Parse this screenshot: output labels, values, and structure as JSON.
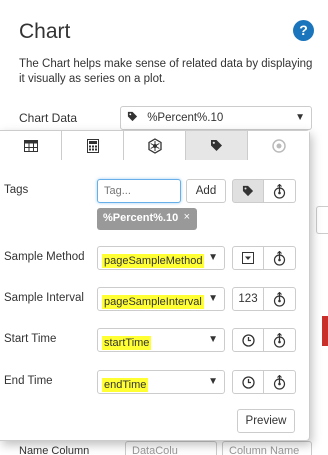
{
  "panel": {
    "title": "Chart",
    "description": "The Chart helps make sense of related data by displaying it visually as series on a plot.",
    "chart_data_label": "Chart Data",
    "chart_data_value": "%Percent%.10",
    "bottom_label": "Name Column",
    "bottom_select_1": "DataColu",
    "bottom_select_2": "Column Name"
  },
  "tabs": [
    {
      "icon": "table-icon"
    },
    {
      "icon": "calculator-icon"
    },
    {
      "icon": "hexagon-network-icon"
    },
    {
      "icon": "tag-icon",
      "active": true
    },
    {
      "icon": "record-icon"
    }
  ],
  "form": {
    "tags_label": "Tags",
    "tag_placeholder": "Tag...",
    "add_label": "Add",
    "chip_label": "%Percent%.10",
    "chip_remove": "×",
    "sample_method_label": "Sample Method",
    "sample_method_value": "pageSampleMethod",
    "sample_interval_label": "Sample Interval",
    "sample_interval_value": "pageSampleInterval",
    "sample_interval_unit": "123",
    "start_time_label": "Start Time",
    "start_time_value": "startTime",
    "end_time_label": "End Time",
    "end_time_value": "endTime",
    "preview_label": "Preview"
  },
  "colors": {
    "highlight": "#ffff33",
    "accent": "#1b75bc",
    "chip_bg": "#999999"
  }
}
